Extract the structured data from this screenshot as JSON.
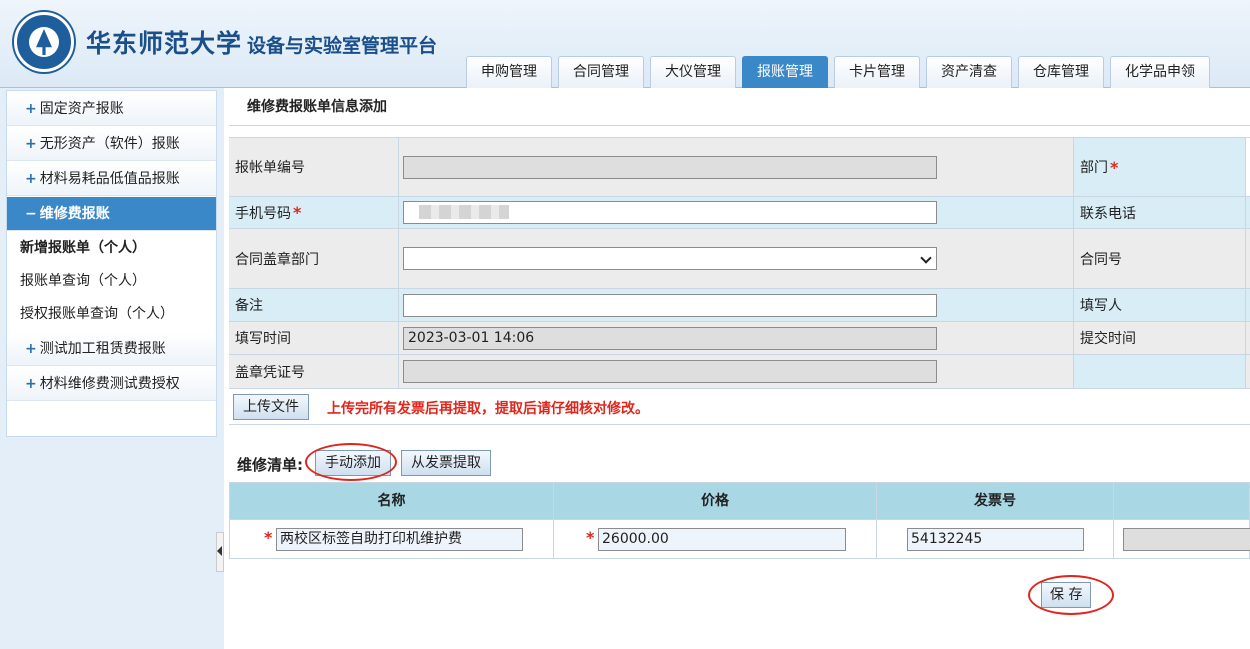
{
  "header": {
    "university": "华东师范大学",
    "platform": "设备与实验室管理平台",
    "tabs": [
      "申购管理",
      "合同管理",
      "大仪管理",
      "报账管理",
      "卡片管理",
      "资产清查",
      "仓库管理",
      "化学品申领"
    ],
    "active_tab": "报账管理"
  },
  "sidebar": {
    "items": [
      {
        "label": "固定资产报账",
        "prefix": "+"
      },
      {
        "label": "无形资产（软件）报账",
        "prefix": "+"
      },
      {
        "label": "材料易耗品低值品报账",
        "prefix": "+"
      },
      {
        "label": "维修费报账",
        "prefix": "−"
      }
    ],
    "sub_items": [
      "新增报账单（个人）",
      "报账单查询（个人）",
      "授权报账单查询（个人）"
    ],
    "items_after": [
      {
        "label": "测试加工租赁费报账",
        "prefix": "+"
      },
      {
        "label": "材料维修费测试费授权",
        "prefix": "+"
      }
    ]
  },
  "page": {
    "title": "维修费报账单信息添加"
  },
  "form": {
    "bill_no_label": "报帐单编号",
    "dept_label": "部门",
    "phone_label": "手机号码",
    "contact_label": "联系电话",
    "seal_dept_label": "合同盖章部门",
    "contract_no_label": "合同号",
    "note_label": "备注",
    "filler_label": "填写人",
    "fill_time_label": "填写时间",
    "fill_time_value": "2023-03-01 14:06",
    "submit_time_label": "提交时间",
    "seal_voucher_label": "盖章凭证号"
  },
  "upload": {
    "button": "上传文件",
    "warning": "上传完所有发票后再提取，提取后请仔细核对修改。"
  },
  "repair": {
    "label": "维修清单:",
    "manual_add": "手动添加",
    "extract": "从发票提取",
    "columns": [
      "名称",
      "价格",
      "发票号"
    ],
    "rows": [
      {
        "name": "两校区标签自助打印机维护费",
        "price": "26000.00",
        "invoice": "54132245"
      }
    ]
  },
  "actions": {
    "save": "保 存"
  },
  "colors": {
    "accent": "#3b88c9",
    "warning": "#e0261c",
    "label_bg": "#d8edf6",
    "table_head": "#a9d8e4"
  }
}
